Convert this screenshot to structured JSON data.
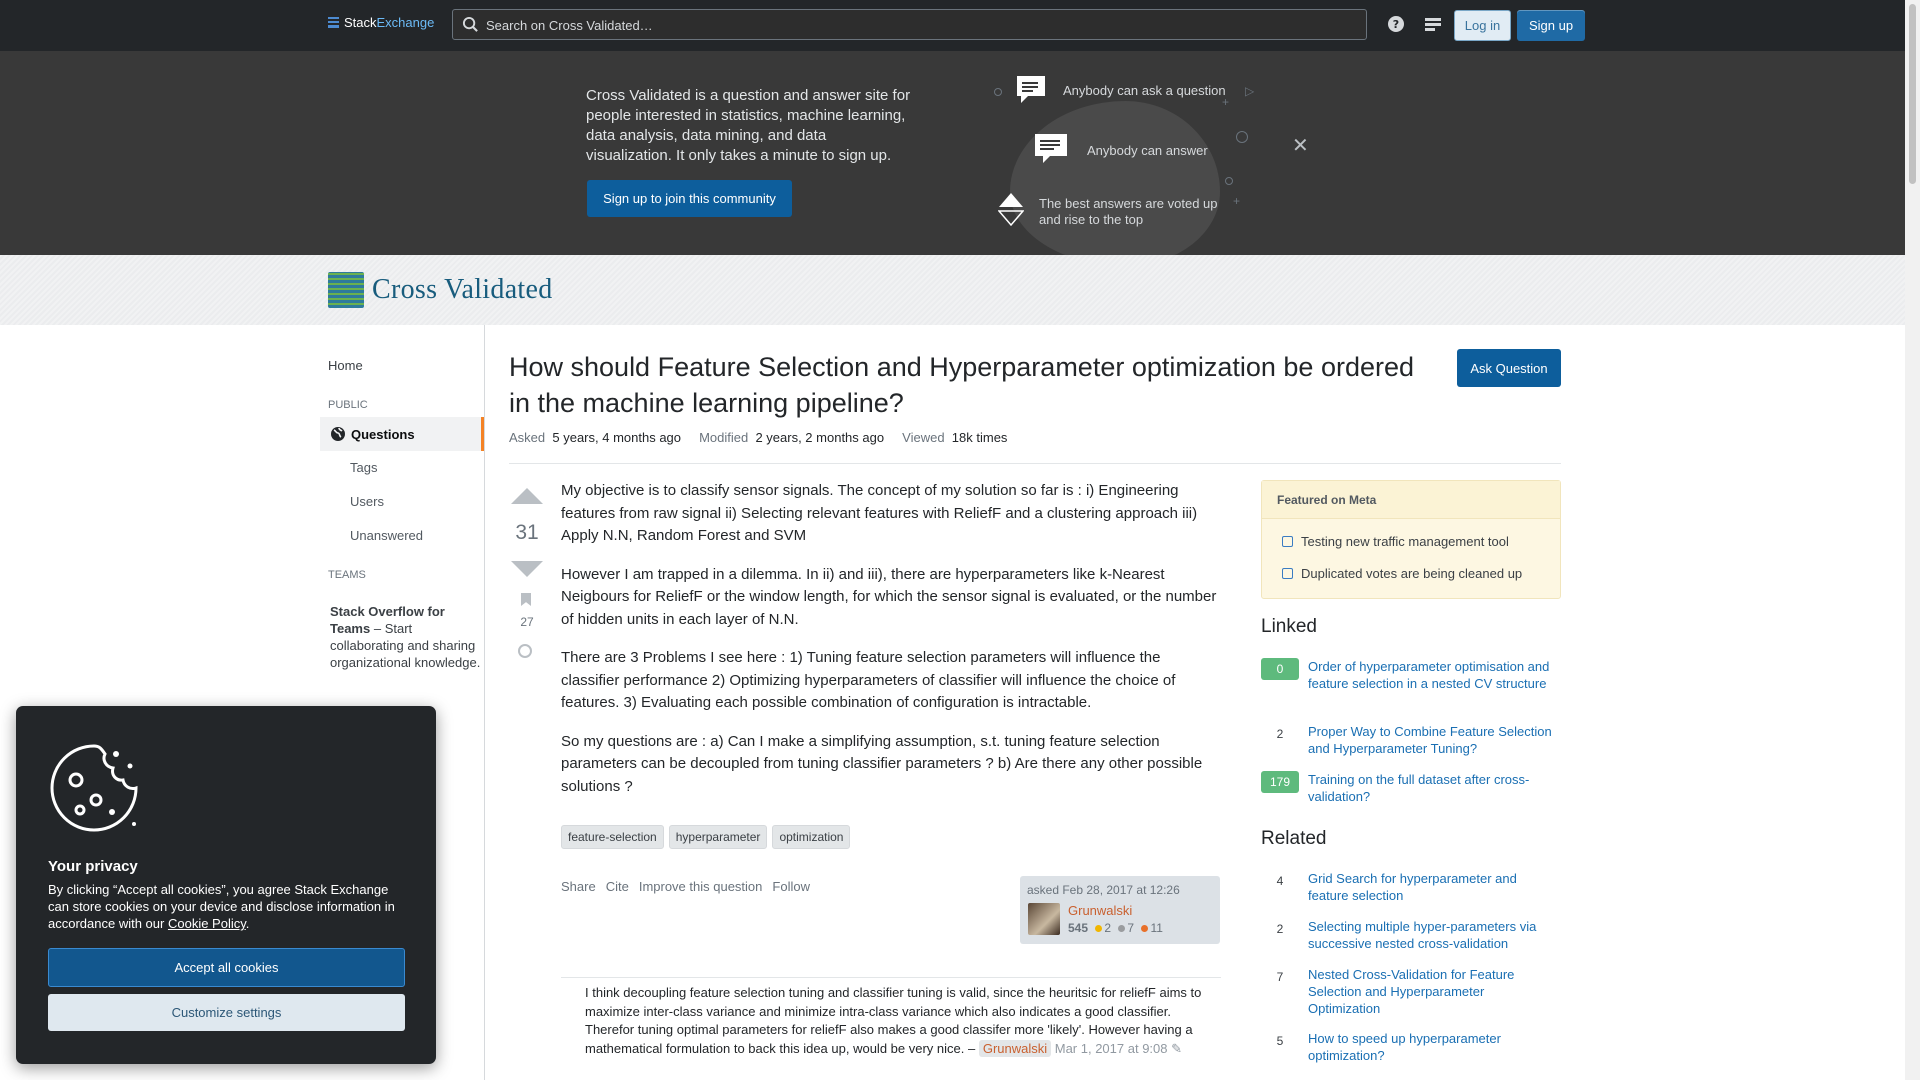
{
  "topbar": {
    "brand_a": "Stack",
    "brand_b": "Exchange",
    "search_placeholder": "Search on Cross Validated…",
    "login": "Log in",
    "signup": "Sign up"
  },
  "hero": {
    "text": "Cross Validated is a question and answer site for people interested in statistics, machine learning, data analysis, data mining, and data visualization. It only takes a minute to sign up.",
    "button": "Sign up to join this community",
    "item1": "Anybody can ask a question",
    "item2": "Anybody can answer",
    "item3": "The best answers are voted up and rise to the top"
  },
  "site": {
    "name": "Cross Validated"
  },
  "nav": {
    "home": "Home",
    "public": "PUBLIC",
    "questions": "Questions",
    "tags": "Tags",
    "users": "Users",
    "unanswered": "Unanswered",
    "teams": "TEAMS",
    "teams_title": "Stack Overflow for Teams",
    "teams_desc": " – Start collaborating and sharing organizational knowledge."
  },
  "question": {
    "title": "How should Feature Selection and Hyperparameter optimization be ordered in the machine learning pipeline?",
    "ask_button": "Ask Question",
    "asked_label": "Asked",
    "asked_value": "5 years, 4 months ago",
    "modified_label": "Modified",
    "modified_value": "2 years, 2 months ago",
    "viewed_label": "Viewed",
    "viewed_value": "18k times",
    "votes": "31",
    "bookmarks": "27",
    "paragraphs": [
      "My objective is to classify sensor signals. The concept of my solution so far is : i) Engineering features from raw signal ii) Selecting relevant features with ReliefF and a clustering approach iii) Apply N.N, Random Forest and SVM",
      "However I am trapped in a dilemma. In ii) and iii), there are hyperparameters like k-Nearest Neigbours for ReliefF or the window length, for which the sensor signal is evaluated, or the number of hidden units in each layer of N.N.",
      "There are 3 Problems I see here : 1) Tuning feature selection parameters will influence the classifier performance 2) Optimizing hyperparameters of classifier will influence the choice of features. 3) Evaluating each possible combination of configuration is intractable.",
      "So my questions are : a) Can I make a simplifying assumption, s.t. tuning feature selection parameters can be decoupled from tuning classifier parameters ? b) Are there any other possible solutions ?"
    ],
    "tags": [
      "feature-selection",
      "hyperparameter",
      "optimization"
    ],
    "actions": [
      "Share",
      "Cite",
      "Improve this question",
      "Follow"
    ],
    "owner": {
      "asked": "asked Feb 28, 2017 at 12:26",
      "name": "Grunwalski",
      "rep": "545",
      "gold": "2",
      "silver": "7",
      "bronze": "11"
    },
    "comment": {
      "text": "I think decoupling feature selection tuning and classifier tuning is valid, since the heuritsic for reliefF aims to maximize inter-class variance and minimize intra-class variance which also indicates a good classifier. Therefor tuning optimal parameters for reliefF also makes a good classifer more 'likely'. However having a mathematical formulation to back this idea up, would be very nice. –",
      "user": "Grunwalski",
      "date": "Mar 1, 2017 at 9:08"
    }
  },
  "sidebar": {
    "featured_title": "Featured on Meta",
    "featured": [
      "Testing new traffic management tool",
      "Duplicated votes are being cleaned up"
    ],
    "linked_title": "Linked",
    "linked": [
      {
        "count": "0",
        "title": "Order of hyperparameter optimisation and feature selection in a nested CV structure",
        "accepted": true
      },
      {
        "count": "2",
        "title": "Proper Way to Combine Feature Selection and Hyperparameter Tuning?",
        "accepted": false
      },
      {
        "count": "179",
        "title": "Training on the full dataset after cross-validation?",
        "accepted": true
      }
    ],
    "related_title": "Related",
    "related": [
      {
        "count": "4",
        "title": "Grid Search for hyperparameter and feature selection"
      },
      {
        "count": "2",
        "title": "Selecting multiple hyper-parameters via successive nested cross-validation"
      },
      {
        "count": "7",
        "title": "Nested Cross-Validation for Feature Selection and Hyperparameter Optimization"
      },
      {
        "count": "5",
        "title": "How to speed up hyperparameter optimization?"
      }
    ]
  },
  "cookie": {
    "title": "Your privacy",
    "text": "By clicking “Accept all cookies”, you agree Stack Exchange can store cookies on your device and disclose information in accordance with our",
    "policy": "Cookie Policy",
    "accept": "Accept all cookies",
    "customize": "Customize settings"
  }
}
